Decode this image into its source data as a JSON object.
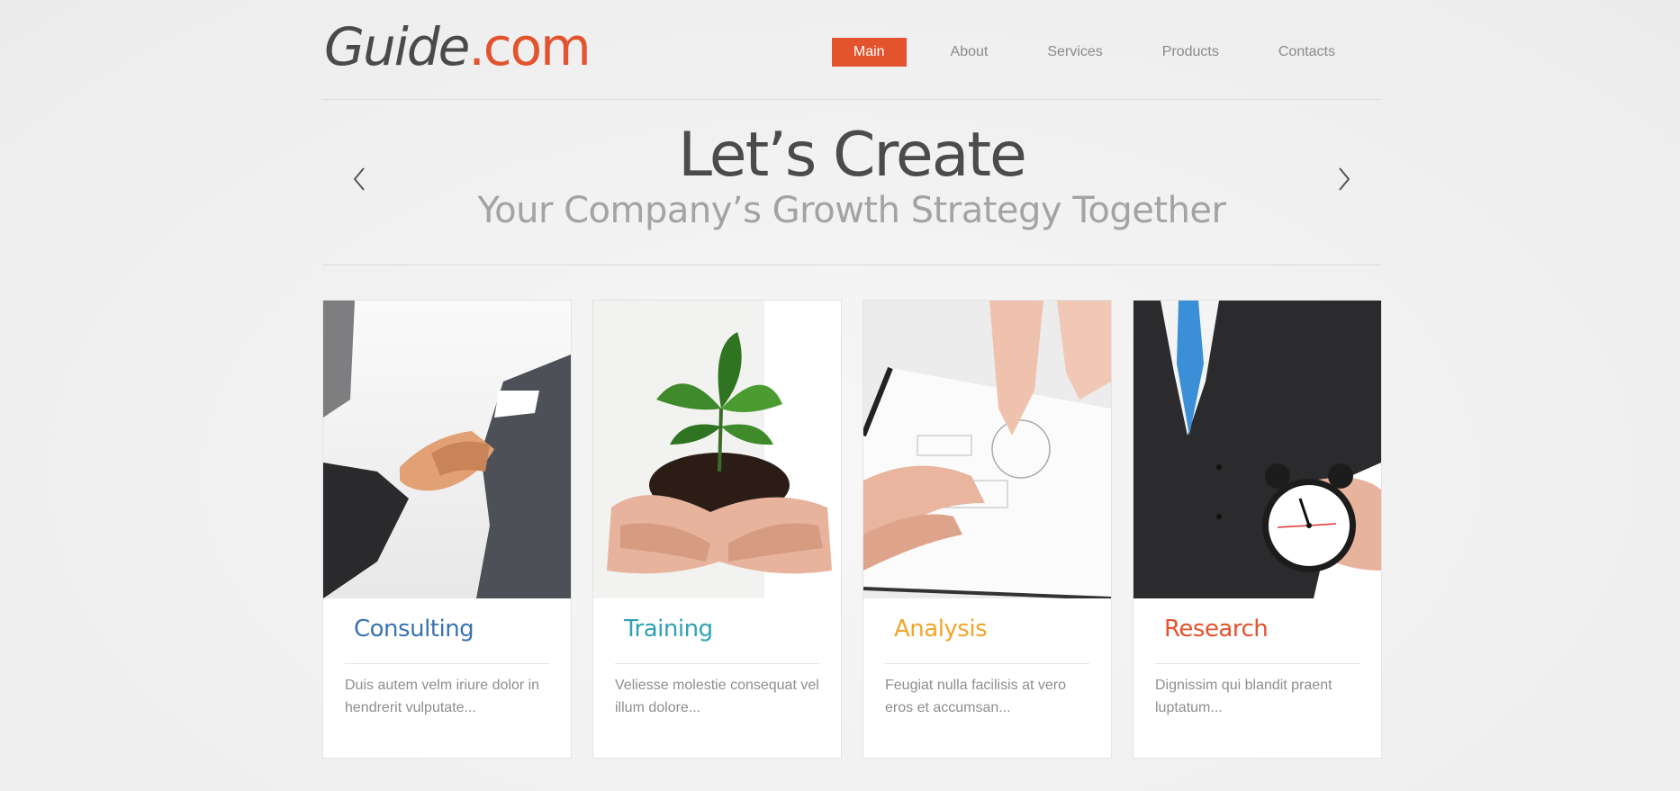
{
  "logo": {
    "part1": "Guide",
    "part2": ".com"
  },
  "nav": {
    "items": [
      {
        "label": "Main",
        "active": true
      },
      {
        "label": "About"
      },
      {
        "label": "Services"
      },
      {
        "label": "Products"
      },
      {
        "label": "Contacts"
      }
    ]
  },
  "slider": {
    "title": "Let’s Create",
    "subtitle": "Your Company’s Growth Strategy Together",
    "prev_icon": "chevron-left-icon",
    "next_icon": "chevron-right-icon"
  },
  "cards": [
    {
      "title": "Consulting",
      "color": "#3a74b0",
      "text": "Duis autem velm iriure dolor in hendrerit vulputate...",
      "image": "handshake"
    },
    {
      "title": "Training",
      "color": "#2fa3b3",
      "text": "Veliesse molestie consequat vel illum dolore...",
      "image": "plant-in-hands"
    },
    {
      "title": "Analysis",
      "color": "#f0a62b",
      "text": "Feugiat nulla facilisis at vero eros et accumsan...",
      "image": "hands-on-documents"
    },
    {
      "title": "Research",
      "color": "#e2532e",
      "text": "Dignissim qui blandit praent luptatum...",
      "image": "businessman-with-clock"
    }
  ],
  "colors": {
    "accent": "#e2532e",
    "dark_text": "#4a4a4a",
    "muted_text": "#8e8e8e"
  }
}
